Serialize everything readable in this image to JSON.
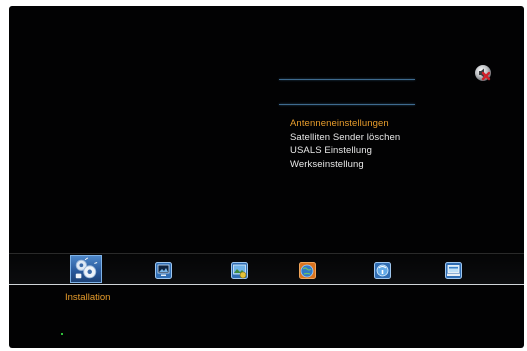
{
  "menu": {
    "items": [
      {
        "label": "Antenneneinstellungen",
        "selected": true
      },
      {
        "label": "Satelliten Sender löschen",
        "selected": false
      },
      {
        "label": "USALS Einstellung",
        "selected": false
      },
      {
        "label": "Werkseinstellung",
        "selected": false
      }
    ]
  },
  "taskbar": {
    "items": [
      {
        "icon": "installation-icon",
        "active": true
      },
      {
        "icon": "tv-icon",
        "active": false
      },
      {
        "icon": "media-icon",
        "active": false
      },
      {
        "icon": "globe-icon",
        "active": false
      },
      {
        "icon": "info-icon",
        "active": false
      },
      {
        "icon": "system-icon",
        "active": false
      }
    ],
    "caption": "Installation"
  },
  "colors": {
    "background": "#020203",
    "selected_text": "#e89d2c",
    "text": "#e9e9e9",
    "accent_line": "#3e6a8e"
  }
}
